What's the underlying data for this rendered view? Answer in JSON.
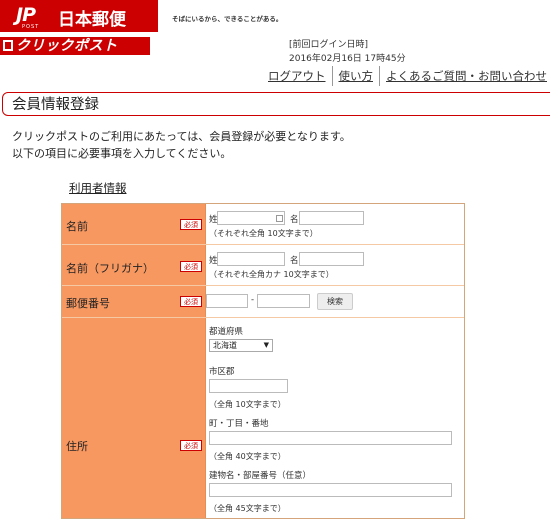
{
  "header": {
    "brand_mark": "JP",
    "brand_post": "POST",
    "brand_name": "日本郵便",
    "tagline": "そばにいるから、できることがある。",
    "service_logo": "クリックポスト",
    "last_login_label": "[前回ログイン日時]",
    "last_login_value": "2016年02月16日 17時45分",
    "nav": {
      "logout": "ログアウト",
      "howto": "使い方",
      "faq": "よくあるご質問・お問い合わせ"
    }
  },
  "page": {
    "title": "会員情報登録",
    "intro_line1": "クリックポストのご利用にあたっては、会員登録が必要となります。",
    "intro_line2": "以下の項目に必要事項を入力してください。",
    "section_title": "利用者情報"
  },
  "form": {
    "required_badge": "必須",
    "name": {
      "label": "名前",
      "sei_label": "姓",
      "mei_label": "名",
      "note": "（それぞれ全角 10文字まで）",
      "sei_value": "",
      "mei_value": ""
    },
    "kana": {
      "label": "名前（フリガナ）",
      "sei_label": "姓",
      "mei_label": "名",
      "note": "（それぞれ全角カナ 10文字まで）",
      "sei_value": "",
      "mei_value": ""
    },
    "postal": {
      "label": "郵便番号",
      "separator": "-",
      "search_button": "検索",
      "part1_value": "",
      "part2_value": ""
    },
    "address": {
      "label": "住所",
      "prefecture_label": "都道府県",
      "prefecture_value": "北海道",
      "city_label": "市区郡",
      "city_note": "（全角 10文字まで）",
      "town_label": "町・丁目・番地",
      "town_note": "（全角 40文字まで）",
      "building_label": "建物名・部屋番号（任意）",
      "building_note": "（全角 45文字まで）"
    }
  },
  "colors": {
    "brand_red": "#cc0000",
    "label_orange": "#f79861"
  }
}
